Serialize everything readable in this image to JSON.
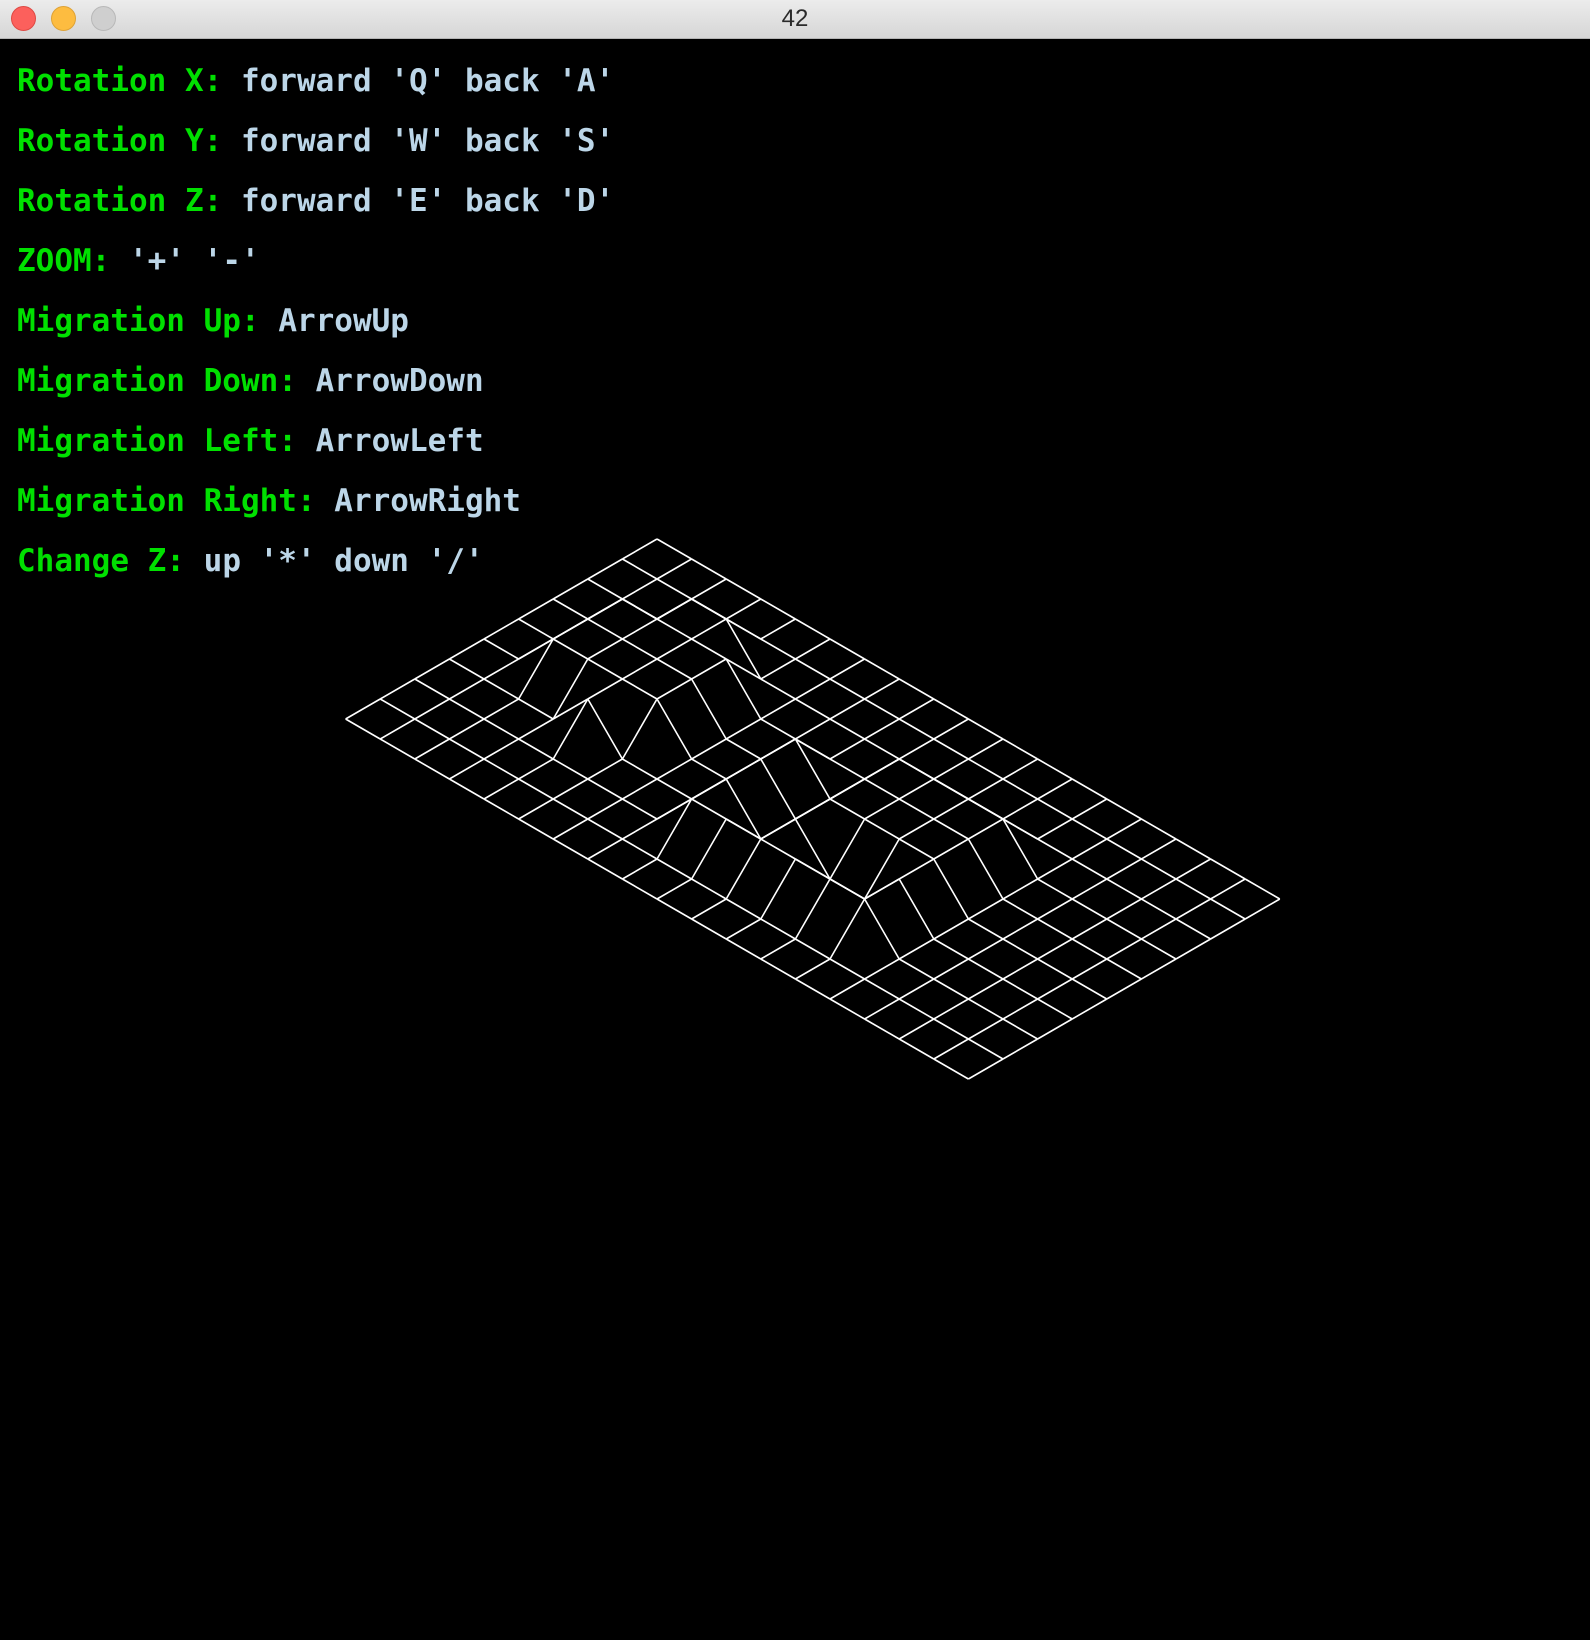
{
  "window": {
    "title": "42"
  },
  "controls": [
    {
      "key": "Rotation X:",
      "value": "forward 'Q' back 'A'"
    },
    {
      "key": "Rotation Y:",
      "value": "forward 'W' back 'S'"
    },
    {
      "key": "Rotation Z:",
      "value": "forward 'E' back 'D'"
    },
    {
      "key": "ZOOM:",
      "value": "'+' '-'"
    },
    {
      "key": "Migration Up:",
      "value": "ArrowUp"
    },
    {
      "key": "Migration Down:",
      "value": "ArrowDown"
    },
    {
      "key": "Migration Left:",
      "value": "ArrowLeft"
    },
    {
      "key": "Migration Right:",
      "value": "ArrowRight"
    },
    {
      "key": "Change Z:",
      "value": "up '*' down '/'"
    }
  ],
  "heightmap": [
    [
      0,
      0,
      0,
      0,
      0,
      0,
      0,
      0,
      0,
      0,
      0,
      0,
      0,
      0,
      0,
      0,
      0,
      0,
      0
    ],
    [
      0,
      0,
      0,
      0,
      0,
      0,
      0,
      0,
      0,
      0,
      0,
      0,
      0,
      0,
      0,
      0,
      0,
      0,
      0
    ],
    [
      0,
      0,
      0,
      10,
      10,
      0,
      0,
      0,
      0,
      0,
      0,
      0,
      0,
      0,
      0,
      0,
      0,
      0,
      0
    ],
    [
      0,
      0,
      10,
      10,
      10,
      10,
      0,
      0,
      0,
      0,
      10,
      10,
      10,
      10,
      0,
      0,
      0,
      0,
      0
    ],
    [
      0,
      0,
      10,
      10,
      10,
      10,
      0,
      0,
      10,
      0,
      10,
      10,
      10,
      10,
      0,
      0,
      0,
      0,
      0
    ],
    [
      0,
      0,
      10,
      10,
      10,
      10,
      0,
      0,
      10,
      0,
      10,
      10,
      10,
      10,
      0,
      0,
      0,
      0,
      0
    ],
    [
      0,
      0,
      0,
      0,
      10,
      0,
      0,
      0,
      10,
      0,
      10,
      0,
      0,
      10,
      0,
      0,
      0,
      0,
      0
    ],
    [
      0,
      0,
      0,
      0,
      0,
      0,
      0,
      0,
      10,
      10,
      10,
      10,
      10,
      10,
      0,
      0,
      0,
      0,
      0
    ],
    [
      0,
      0,
      0,
      0,
      0,
      0,
      0,
      0,
      0,
      0,
      0,
      0,
      0,
      0,
      0,
      0,
      0,
      0,
      0
    ],
    [
      0,
      0,
      0,
      0,
      0,
      0,
      0,
      0,
      0,
      0,
      0,
      0,
      0,
      0,
      0,
      0,
      0,
      0,
      0
    ]
  ]
}
